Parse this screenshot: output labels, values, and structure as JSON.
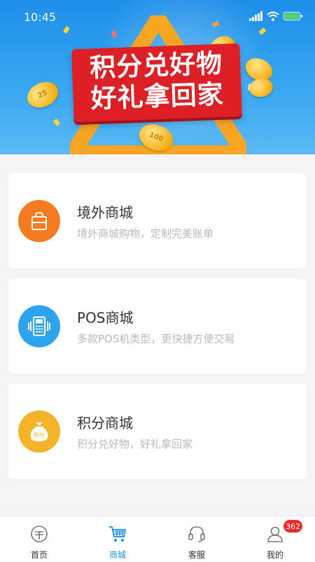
{
  "status_bar": {
    "time": "10:45"
  },
  "banner": {
    "line1": "积分兑好物",
    "line2": "好礼拿回家",
    "coin_labels": [
      "25",
      "100"
    ]
  },
  "mall_items": [
    {
      "title": "境外商城",
      "subtitle": "境外商城购物，定制完美账单",
      "icon": "shopping-bag-icon",
      "icon_color": "#f57b21"
    },
    {
      "title": "POS商城",
      "subtitle": "多款POS机类型，更快捷方便交易",
      "icon": "pos-machine-icon",
      "icon_color": "#2fa4ee"
    },
    {
      "title": "积分商城",
      "subtitle": "积分兑好物，好礼拿回家",
      "icon": "points-bag-icon",
      "icon_color": "#f5b32a",
      "icon_text": "积分"
    }
  ],
  "tab_bar": {
    "tabs": [
      {
        "label": "首页",
        "icon": "home-icon"
      },
      {
        "label": "商城",
        "icon": "cart-icon",
        "active": true
      },
      {
        "label": "客服",
        "icon": "headset-icon"
      },
      {
        "label": "我的",
        "icon": "user-icon",
        "badge": "362"
      }
    ]
  },
  "colors": {
    "accent": "#1a8ee6",
    "badge": "#ee2b2b",
    "banner_red": "#dd1f26"
  }
}
